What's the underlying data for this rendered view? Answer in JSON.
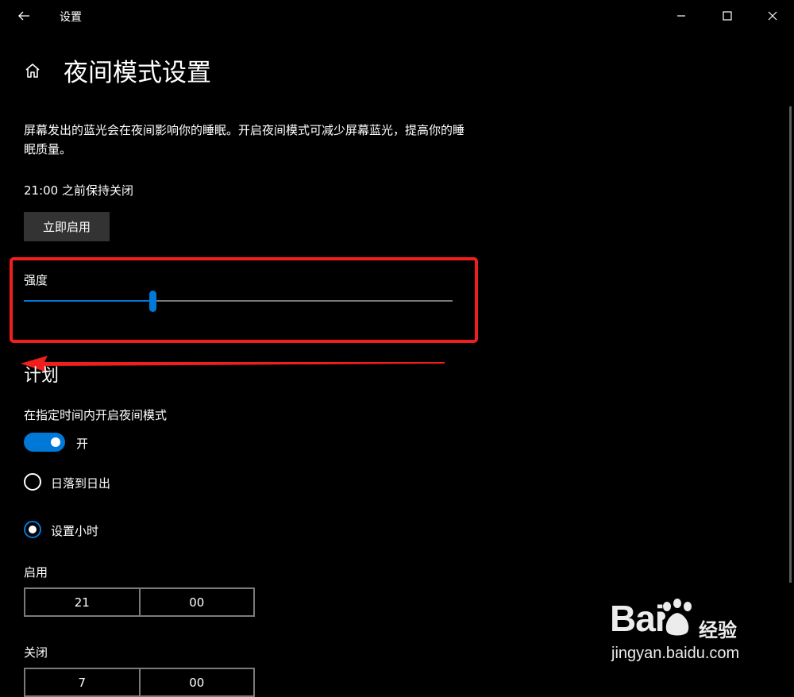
{
  "window": {
    "title": "设置"
  },
  "header": {
    "title": "夜间模式设置"
  },
  "description": "屏幕发出的蓝光会在夜间影响你的睡眠。开启夜间模式可减少屏幕蓝光，提高你的睡眠质量。",
  "status_text": "21:00 之前保持关闭",
  "enable_now_button": "立即启用",
  "strength": {
    "label": "强度",
    "value_fraction": 0.3
  },
  "schedule": {
    "section_title": "计划",
    "toggle_label": "在指定时间内开启夜间模式",
    "toggle_state": "开",
    "options": [
      {
        "label": "日落到日出",
        "selected": false
      },
      {
        "label": "设置小时",
        "selected": true
      }
    ],
    "on_time": {
      "label": "启用",
      "hour": "21",
      "minute": "00"
    },
    "off_time": {
      "label": "关闭",
      "hour": "7",
      "minute": "00"
    }
  },
  "watermark": {
    "logo": "Baidu经验",
    "url": "jingyan.baidu.com"
  },
  "colors": {
    "accent": "#0078d7",
    "annotation": "#f01e1e",
    "background": "#000000"
  }
}
